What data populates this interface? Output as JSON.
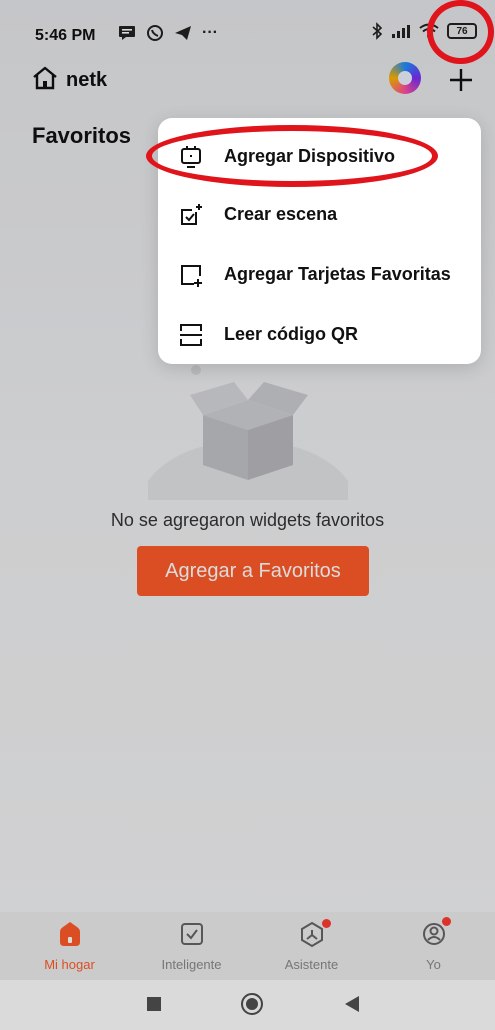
{
  "status_bar": {
    "time": "5:46 PM",
    "battery": "76"
  },
  "header": {
    "home_name": "netk"
  },
  "favorites": {
    "title": "Favoritos",
    "empty_text": "No se agregaron widgets favoritos",
    "add_button": "Agregar a Favoritos"
  },
  "menu": {
    "items": [
      {
        "label": "Agregar Dispositivo",
        "icon": "add-device-icon"
      },
      {
        "label": "Crear escena",
        "icon": "create-scene-icon"
      },
      {
        "label": "Agregar Tarjetas Favoritas",
        "icon": "add-card-icon"
      },
      {
        "label": "Leer código QR",
        "icon": "scan-qr-icon"
      }
    ]
  },
  "bottom_nav": {
    "items": [
      {
        "label": "Mi hogar",
        "icon": "home-icon",
        "active": true
      },
      {
        "label": "Inteligente",
        "icon": "checkbox-icon",
        "active": false
      },
      {
        "label": "Asistente",
        "icon": "assistant-icon",
        "active": false,
        "badge": true
      },
      {
        "label": "Yo",
        "icon": "profile-icon",
        "active": false,
        "badge": true
      }
    ]
  },
  "colors": {
    "accent": "#ff5b2a",
    "highlight_ring": "#e0141b",
    "menu_bg": "#ffffff"
  }
}
